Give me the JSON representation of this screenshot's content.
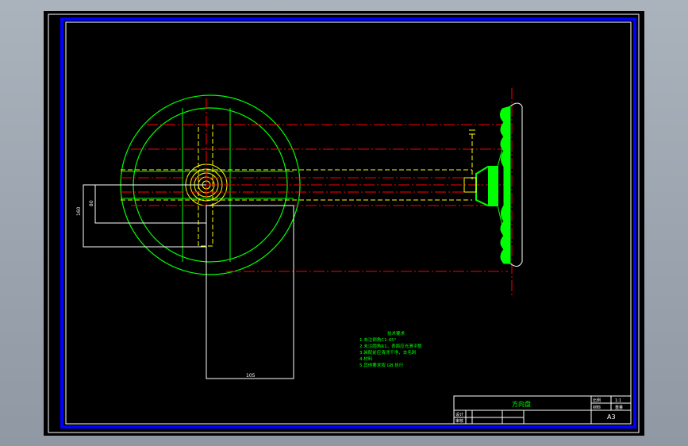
{
  "drawing": {
    "title": "方向盘",
    "paper_size": "A3",
    "colors": {
      "background": "#000000",
      "border_blue": "#0000ff",
      "outline_white": "#ffffff",
      "geometry_green": "#00ff00",
      "centerline_red": "#ff0000",
      "hidden_yellow": "#ffff00"
    }
  },
  "dimensions": {
    "vertical_outer": "160",
    "vertical_inner": "80",
    "horizontal_bottom": "105"
  },
  "tech_notes": {
    "heading": "技术要求",
    "line1": "1.未注倒角C1-45°",
    "line2": "2.未注圆角R1，表面应光滑平整",
    "line3": "3.装配前应清洗干净，去毛刺",
    "line4": "4.材料",
    "line5": "5.其他要求按 GB 执行"
  },
  "title_block": {
    "name_label": "方向盘",
    "sheet_size": "A3",
    "cell_ratio": "比例",
    "cell_ratio_value": "1:1",
    "cell_material": "材料",
    "cell_weight": "重量",
    "cell_drawn": "设计",
    "cell_check": "审核"
  }
}
